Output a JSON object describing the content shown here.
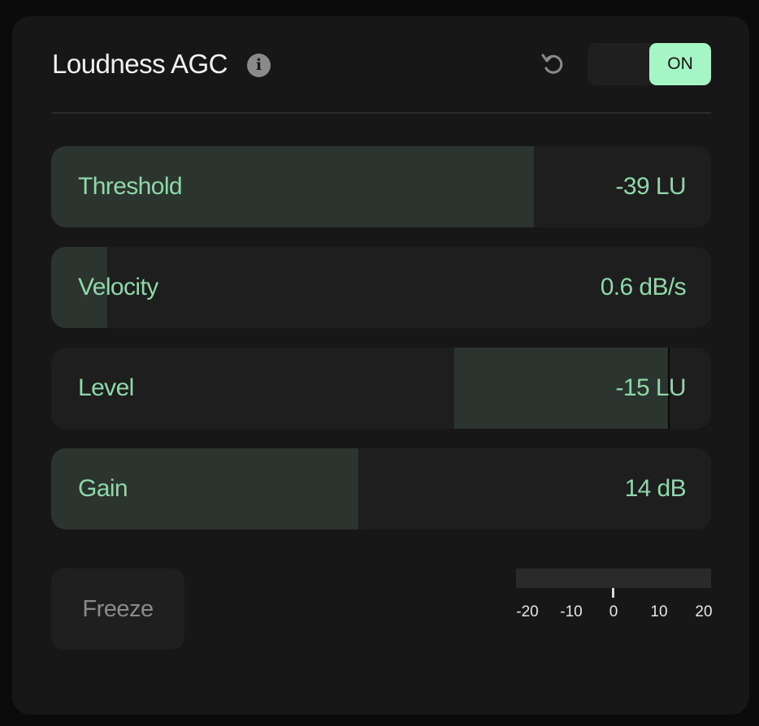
{
  "header": {
    "title": "Loudness AGC",
    "info_icon": "info-icon",
    "info_glyph": "i",
    "reset_icon": "reset-icon",
    "toggle_label": "ON",
    "toggle_state": true
  },
  "params": [
    {
      "label": "Threshold",
      "value": "-39 LU",
      "fill_fraction": 0.732
    },
    {
      "label": "Velocity",
      "value": "0.6 dB/s",
      "fill_fraction": 0.085
    },
    {
      "label": "Level",
      "value": "-15 LU",
      "fill_from_fraction": 0.611,
      "fill_to_fraction": 0.935
    },
    {
      "label": "Gain",
      "value": "14 dB",
      "fill_fraction": 0.466
    }
  ],
  "freeze_label": "Freeze",
  "meter": {
    "ticks": [
      "-20",
      "-10",
      "0",
      "10",
      "20"
    ],
    "value": 0
  },
  "colors": {
    "accent": "#a6f5c4",
    "param_text": "#8fd8a8",
    "param_fill": "#2c3430",
    "panel_bg": "#171717"
  }
}
